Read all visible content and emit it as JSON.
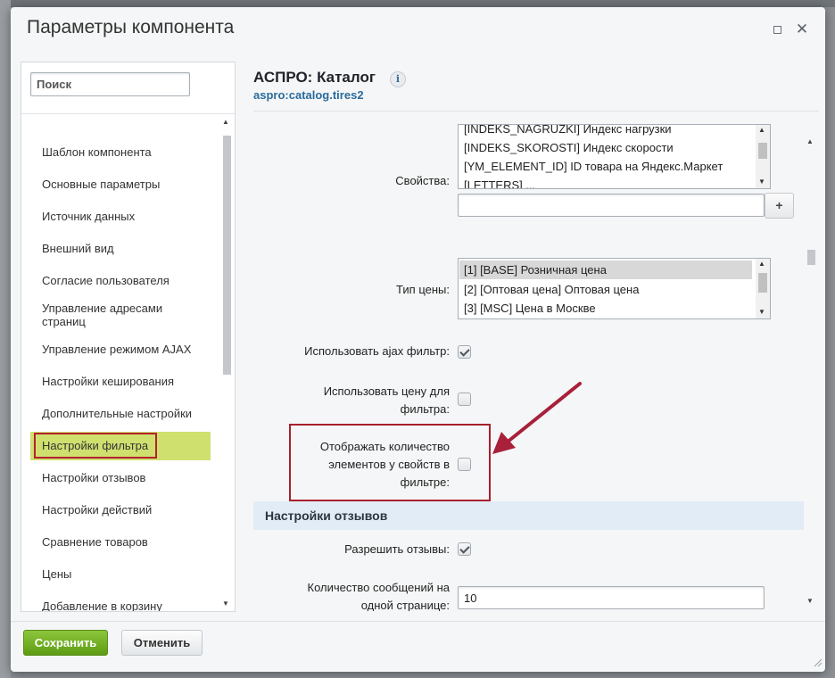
{
  "dialog": {
    "title": "Параметры компонента",
    "maximize_icon": "maximize-icon",
    "close_icon": "close-icon",
    "close_glyph": "✕"
  },
  "sidebar": {
    "search_placeholder": "Поиск",
    "items": [
      {
        "label": "Шаблон компонента"
      },
      {
        "label": "Основные параметры"
      },
      {
        "label": "Источник данных"
      },
      {
        "label": "Внешний вид"
      },
      {
        "label": "Согласие пользователя"
      },
      {
        "label": "Управление адресами страниц"
      },
      {
        "label": "Управление режимом AJAX"
      },
      {
        "label": "Настройки кеширования"
      },
      {
        "label": "Дополнительные настройки"
      },
      {
        "label": "Настройки фильтра"
      },
      {
        "label": "Настройки отзывов"
      },
      {
        "label": "Настройки действий"
      },
      {
        "label": "Сравнение товаров"
      },
      {
        "label": "Цены"
      },
      {
        "label": "Добавление в корзину"
      }
    ],
    "active_item": "Настройки фильтра",
    "active_color": "#cfe06f",
    "highlight_color": "#b4222d"
  },
  "component": {
    "title": "АСПРО: Каталог",
    "code": "aspro:catalog.tires2",
    "info_icon": "info-icon",
    "info_glyph": "i"
  },
  "form": {
    "properties": {
      "label": "Свойства:",
      "options": [
        "[INDEKS_NAGRUZKI] Индекс нагрузки",
        "[INDEKS_SKOROSTI] Индекс скорости",
        "[YM_ELEMENT_ID] ID товара на Яндекс.Маркет",
        "[LETTERS] ..."
      ],
      "add_value": "",
      "add_button": "+"
    },
    "price_type": {
      "label": "Тип цены:",
      "options": [
        "[1] [BASE] Розничная цена",
        "[2] [Оптовая цена] Оптовая цена",
        "[3] [MSC] Цена в Москве"
      ],
      "selected": "[1] [BASE] Розничная цена"
    },
    "use_ajax_filter": {
      "label": "Использовать ajax фильтр:",
      "checked": true
    },
    "use_price_for_filter": {
      "label_line1": "Использовать цену для",
      "label_line2": "фильтра:",
      "checked": false
    },
    "show_elements_count": {
      "label_line1": "Отображать количество",
      "label_line2": "элементов у свойств в",
      "label_line3": "фильтре:",
      "checked": false
    },
    "reviews_section": {
      "title": "Настройки отзывов"
    },
    "allow_reviews": {
      "label": "Разрешить отзывы:",
      "checked": true
    },
    "messages_per_page": {
      "label_line1": "Количество сообщений на",
      "label_line2": "одной странице:",
      "value": "10"
    }
  },
  "footer": {
    "save_label": "Сохранить",
    "cancel_label": "Отменить",
    "save_color": "#6aaa1e"
  },
  "annotation": {
    "arrow_color": "#a8203a",
    "box_color": "#a8202e"
  },
  "scroll_arrows": {
    "up": "▲",
    "down": "▼"
  }
}
